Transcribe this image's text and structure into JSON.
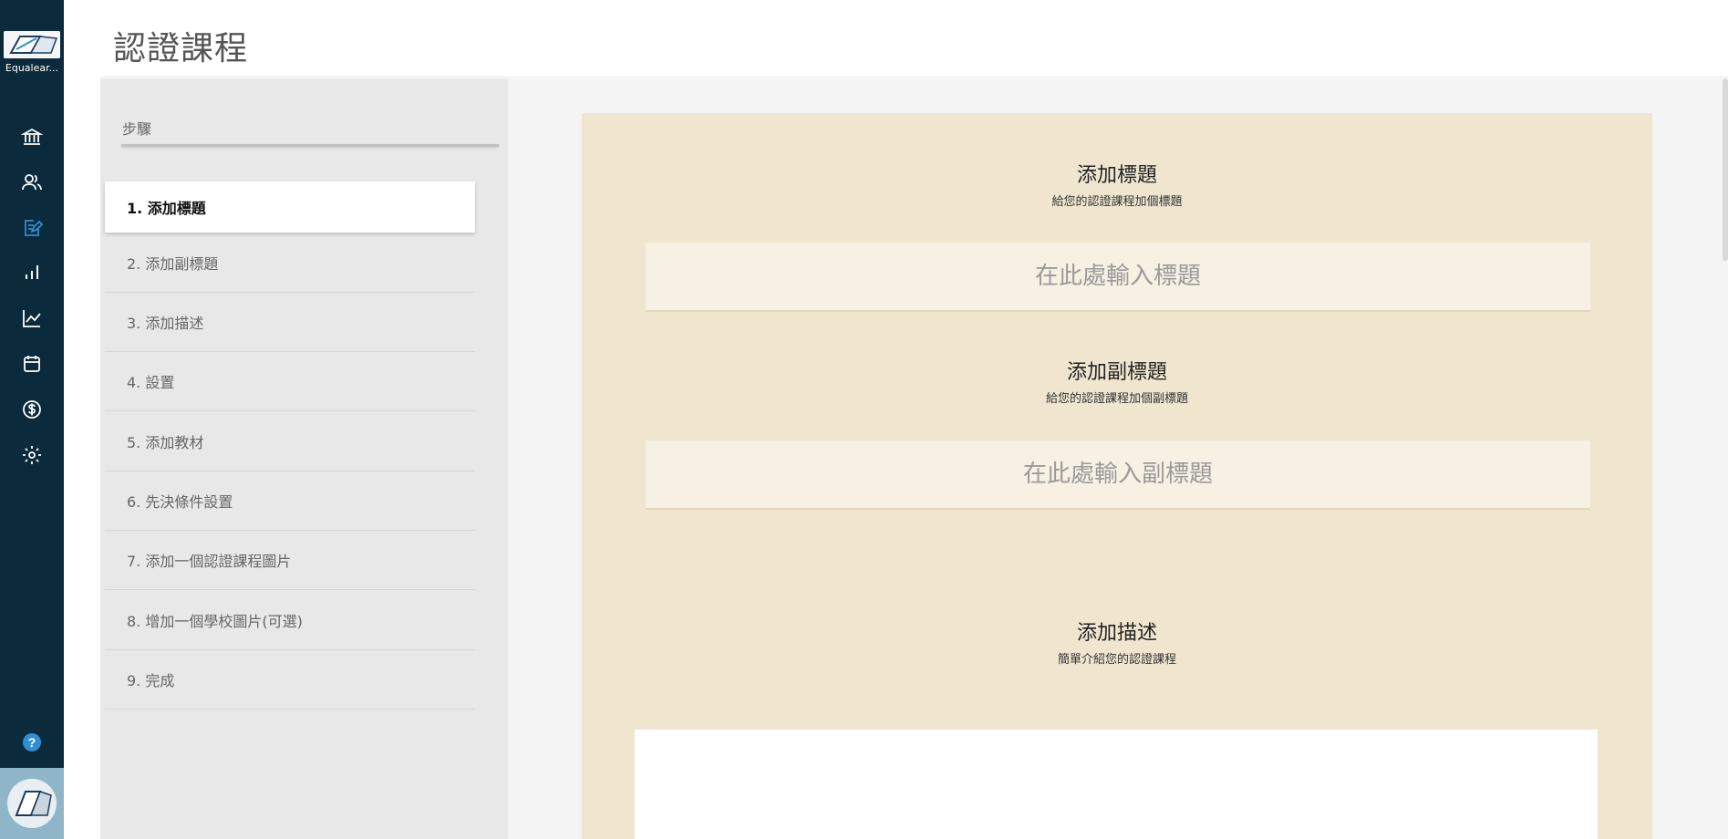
{
  "app": {
    "logo_text": "Equalear...",
    "page_title": "認證課程"
  },
  "rail": {
    "icons": [
      "institution-icon",
      "users-icon",
      "edit-course-icon",
      "bar-chart-icon",
      "line-chart-icon",
      "calendar-icon",
      "dollar-icon",
      "gear-icon"
    ],
    "active_icon": "edit-course-icon",
    "help_label": "?",
    "accent_color": "#2f8fd2",
    "background_color": "#0b2a3c"
  },
  "steps": {
    "heading": "步驟",
    "items": [
      {
        "label": "1. 添加標題",
        "active": true
      },
      {
        "label": "2. 添加副標題",
        "active": false
      },
      {
        "label": "3. 添加描述",
        "active": false
      },
      {
        "label": "4. 設置",
        "active": false
      },
      {
        "label": "5. 添加教材",
        "active": false
      },
      {
        "label": "6. 先決條件設置",
        "active": false
      },
      {
        "label": "7. 添加一個認證課程圖片",
        "active": false
      },
      {
        "label": "8. 增加一個學校圖片(可選)",
        "active": false
      },
      {
        "label": "9. 完成",
        "active": false
      }
    ]
  },
  "form": {
    "title_section": {
      "heading": "添加標題",
      "subheading": "給您的認證課程加個標題",
      "placeholder": "在此處輸入標題"
    },
    "subtitle_section": {
      "heading": "添加副標題",
      "subheading": "給您的認證課程加個副標題",
      "placeholder": "在此處輸入副標題"
    },
    "description_section": {
      "heading": "添加描述",
      "subheading": "簡單介紹您的認證課程"
    },
    "card_color": "#f0e6cf"
  }
}
